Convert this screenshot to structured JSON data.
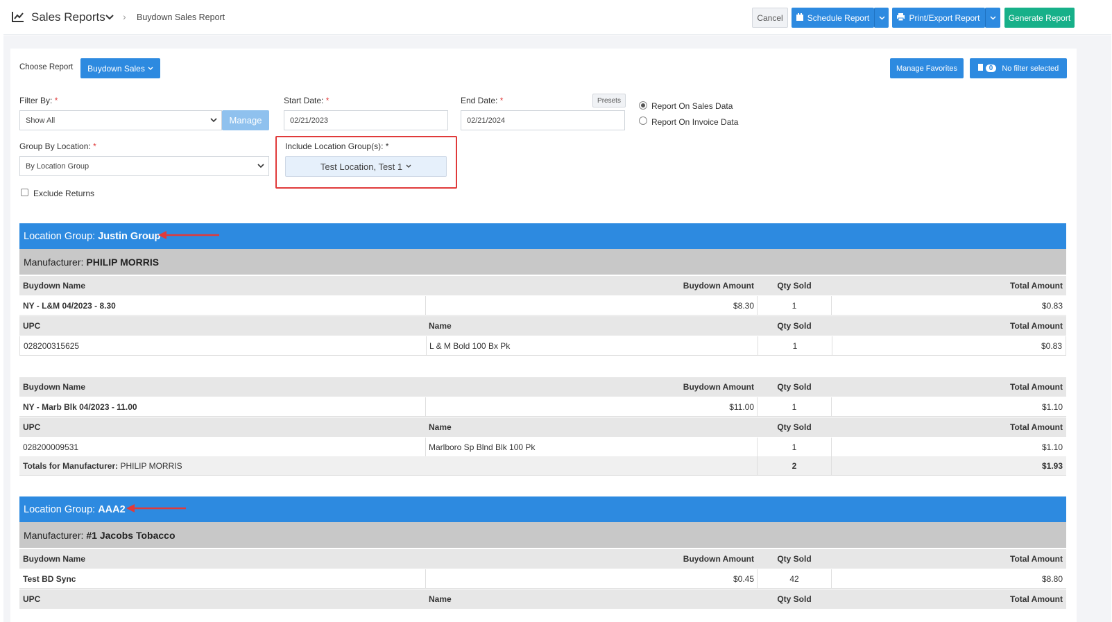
{
  "header": {
    "app_title": "Sales Reports",
    "breadcrumb": "Buydown Sales Report",
    "cancel": "Cancel",
    "schedule": "Schedule Report",
    "print": "Print/Export Report",
    "generate": "Generate Report"
  },
  "controls": {
    "choose_report_label": "Choose Report",
    "choose_report_value": "Buydown Sales",
    "manage_favorites": "Manage Favorites",
    "filter_count": "0",
    "no_filter": "No filter selected",
    "filter_by_label": "Filter By:",
    "filter_by_value": "Show All",
    "manage": "Manage",
    "start_date_label": "Start Date:",
    "start_date": "02/21/2023",
    "end_date_label": "End Date:",
    "end_date": "02/21/2024",
    "presets": "Presets",
    "radio_sales": "Report On Sales Data",
    "radio_invoice": "Report On Invoice Data",
    "group_by_label": "Group By Location:",
    "group_by_value": "By Location Group",
    "include_groups_label": "Include Location Group(s):",
    "include_groups_value": "Test Location, Test 1",
    "exclude_returns": "Exclude Returns",
    "required_mark": "*"
  },
  "report": {
    "location_group_label": "Location Group:",
    "manufacturer_label": "Manufacturer:",
    "col_buydown_name": "Buydown Name",
    "col_buydown_amount": "Buydown Amount",
    "col_qty_sold": "Qty Sold",
    "col_total_amount": "Total Amount",
    "col_upc": "UPC",
    "col_name": "Name",
    "totals_label": "Totals for Manufacturer:",
    "groups": [
      {
        "name": "Justin Group",
        "manufacturer": "PHILIP MORRIS",
        "buydowns": [
          {
            "name": "NY - L&M 04/2023 - 8.30",
            "amount": "$8.30",
            "qty": "1",
            "total": "$0.83",
            "upc": "028200315625",
            "item": "L & M Bold 100 Bx Pk",
            "item_qty": "1",
            "item_total": "$0.83"
          },
          {
            "name": "NY - Marb Blk 04/2023 - 11.00",
            "amount": "$11.00",
            "qty": "1",
            "total": "$1.10",
            "upc": "028200009531",
            "item": "Marlboro Sp Blnd Blk 100 Pk",
            "item_qty": "1",
            "item_total": "$1.10"
          }
        ],
        "totals": {
          "manufacturer": "PHILIP MORRIS",
          "qty": "2",
          "total": "$1.93"
        }
      },
      {
        "name": "AAA2",
        "manufacturer": "#1 Jacobs Tobacco",
        "buydowns": [
          {
            "name": "Test BD Sync",
            "amount": "$0.45",
            "qty": "42",
            "total": "$8.80"
          }
        ]
      }
    ]
  },
  "colors": {
    "primary": "#2d8ae0",
    "success": "#17b089",
    "highlight": "#e03a3a"
  }
}
